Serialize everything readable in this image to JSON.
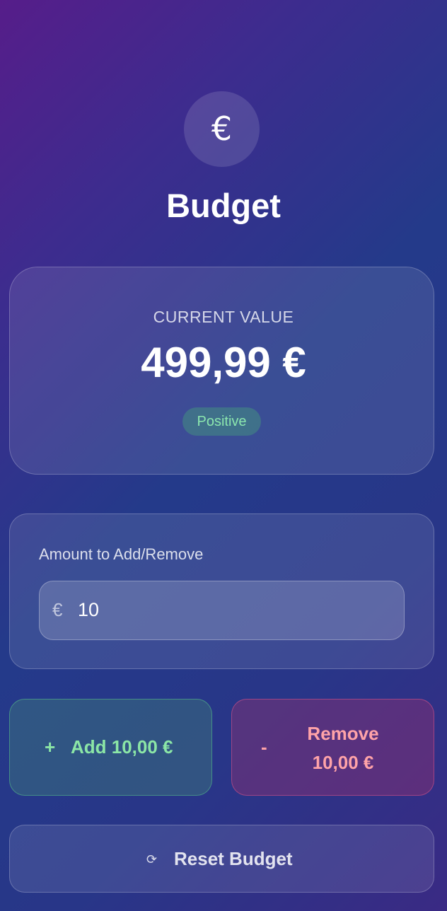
{
  "header": {
    "logo_icon": "euro-icon",
    "logo_glyph": "€",
    "title": "Budget"
  },
  "balance": {
    "label": "CURRENT VALUE",
    "amount": "499,99 €",
    "status": "Positive",
    "status_color": "#8be6ae"
  },
  "amount_input": {
    "label": "Amount to Add/Remove",
    "currency_symbol": "€",
    "value": "10"
  },
  "actions": {
    "add": {
      "sign": "+",
      "label": "Add 10,00 €",
      "color": "#8be6a6"
    },
    "remove": {
      "sign": "-",
      "label": "Remove 10,00 €",
      "color": "#ffa3a8"
    },
    "reset": {
      "icon": "reset-icon",
      "glyph": "⟳",
      "label": "Reset Budget"
    }
  }
}
